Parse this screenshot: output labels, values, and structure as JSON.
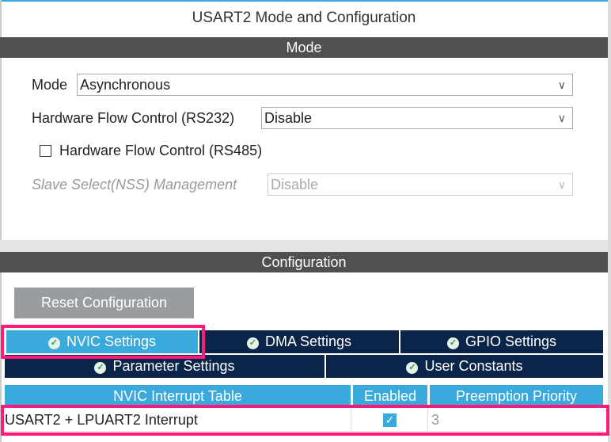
{
  "title": "USART2 Mode and Configuration",
  "mode_section": {
    "header": "Mode",
    "mode_label": "Mode",
    "mode_value": "Asynchronous",
    "hfc232_label": "Hardware Flow Control (RS232)",
    "hfc232_value": "Disable",
    "hfc485_label": "Hardware Flow Control (RS485)",
    "hfc485_checked": false,
    "nss_label": "Slave Select(NSS) Management",
    "nss_value": "Disable"
  },
  "config_section": {
    "header": "Configuration",
    "reset_label": "Reset Configuration",
    "tabs": [
      {
        "label": "NVIC Settings",
        "active": true
      },
      {
        "label": "DMA Settings"
      },
      {
        "label": "GPIO Settings"
      },
      {
        "label": "Parameter Settings"
      },
      {
        "label": "User Constants"
      }
    ],
    "table": {
      "headers": [
        "NVIC Interrupt Table",
        "Enabled",
        "Preemption Priority"
      ],
      "rows": [
        {
          "name": "USART2 + LPUART2 Interrupt",
          "enabled": true,
          "priority": "3"
        }
      ]
    }
  },
  "colors": {
    "highlight": "#ff1b7c",
    "active_tab": "#3aa9dc",
    "tab": "#0b2449"
  }
}
